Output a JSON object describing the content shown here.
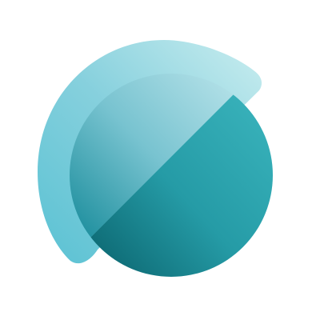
{
  "logo": {
    "icon": "abstract-circle-logo-icon",
    "colors": {
      "background": "#ffffff",
      "arc_light": "#c4ebee",
      "arc_mid": "#86d0dd",
      "arc_dark": "#5ec3d4",
      "circle_top_light": "#b4e1e8",
      "circle_top_mid": "#78c3d0",
      "circle_top_dark": "#1e8f9e",
      "circle_bottom_light": "#37b0b9",
      "circle_bottom_mid": "#259ba6",
      "circle_bottom_dark": "#0c6771"
    }
  }
}
